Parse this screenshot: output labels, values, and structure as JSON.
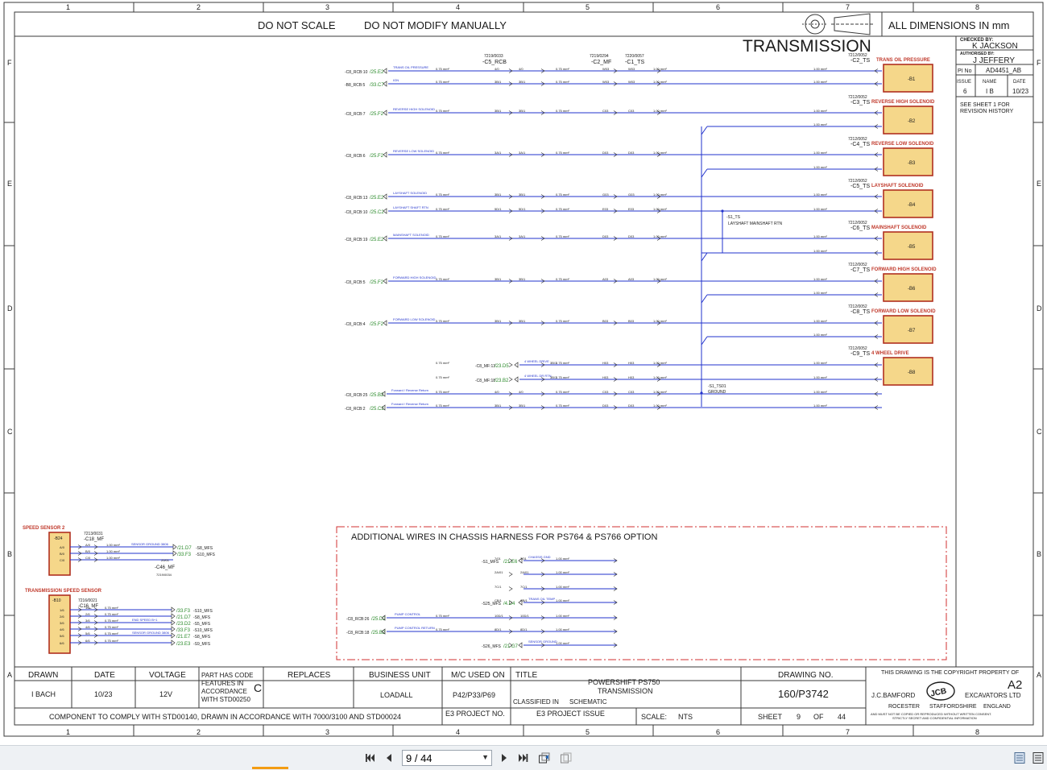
{
  "border": {
    "columns": [
      "1",
      "2",
      "3",
      "4",
      "5",
      "6",
      "7",
      "8"
    ],
    "rows": [
      "F",
      "E",
      "D",
      "C",
      "B",
      "A"
    ]
  },
  "header": {
    "do_not_scale": "DO NOT SCALE",
    "do_not_modify": "DO NOT MODIFY MANUALLY",
    "dimensions": "ALL DIMENSIONS IN mm",
    "sheet_title": "TRANSMISSION"
  },
  "approval": {
    "checked_by_label": "CHECKED BY:",
    "checked_by": "K JACKSON",
    "authorised_by_label": "AUTHORISED BY:",
    "authorised_by": "J JEFFERY",
    "pi_no_label": "PI No",
    "pi_no": "AD4451_AB",
    "issue_label": "ISSUE",
    "name_label": "NAME",
    "date_label": "DATE",
    "issue": "6",
    "name": "I B",
    "date": "10/23",
    "revision_note_1": "SEE SHEET 1 FOR",
    "revision_note_2": "REVISION HISTORY"
  },
  "connectors_top": [
    {
      "part": "7219/0033",
      "name": "-C5_RCB"
    },
    {
      "part": "7219/0294",
      "name": "-C2_MF"
    },
    {
      "part": "7220/0057",
      "name": "-C1_TS"
    }
  ],
  "wires": [
    {
      "src": "-C8_RCB:10",
      "ref": "/25.E2",
      "sig": "TRANS OIL PRESSURE"
    },
    {
      "src": "-B8_RCB:5",
      "ref": "/33.C7",
      "sig": "IGN"
    },
    {
      "src": "-C8_RCB:7",
      "ref": "/25.F2",
      "sig": "REVERSE HIGH SOLENOID"
    },
    {
      "src": "-C8_RCB:6",
      "ref": "/25.F2",
      "sig": "REVERSE LOW SOLENOID"
    },
    {
      "src": "-C8_RCB:13",
      "ref": "/25.E2",
      "sig": "LAYSHAFT SOLENOID"
    },
    {
      "src": "-C8_RCB:10",
      "ref": "/25.C2",
      "sig": "LAYSHAFT SHAFT RTN"
    },
    {
      "src": "-C8_RCB:19",
      "ref": "/25.E2",
      "sig": "MAINSHAFT SOLENOID"
    },
    {
      "src": "-C8_RCB:5",
      "ref": "/25.F2",
      "sig": "FORWARD HIGH SOLENOID"
    },
    {
      "src": "-C8_RCB:4",
      "ref": "/25.F2",
      "sig": "FORWARD LOW SOLENOID"
    },
    {
      "src": "-C8_MF:13",
      "ref": "/23.D5",
      "sig": "4 WHEEL DRIVE"
    },
    {
      "src": "-C8_MF:18",
      "ref": "/23.B2",
      "sig": "4 WHEEL DR RTN"
    },
    {
      "src": "-C8_RCB:25",
      "ref": "/25.B2",
      "sig": "Forward / Reverse Return"
    },
    {
      "src": "-C8_RCB:2",
      "ref": "/25.C2",
      "sig": "Forward / Reverse Return"
    }
  ],
  "wire_codes": {
    "size": "0.75 mm²",
    "size_b": "1.00 mm²",
    "c5": [
      "4/0",
      "3B/1",
      "3B/1",
      "3A/1",
      "3B/1",
      "5D/1",
      "3A/1",
      "3B/1",
      "3B/1",
      "3B/1",
      "3B/1"
    ],
    "c2": [
      "W03",
      "W03",
      "C03",
      "D03",
      "G03",
      "E03",
      "D03",
      "A03",
      "B03",
      "H03",
      "H03",
      "C03",
      "D03"
    ]
  },
  "solenoids": [
    {
      "conn_part": "7212/0052",
      "conn": "-C2_TS",
      "title": "TRANS OIL PRESSURE",
      "id": "-B1"
    },
    {
      "conn_part": "7212/0052",
      "conn": "-C3_TS",
      "title": "REVERSE HIGH SOLENOID",
      "id": "-B2"
    },
    {
      "conn_part": "7212/0052",
      "conn": "-C4_TS",
      "title": "REVERSE LOW SOLENOID",
      "id": "-B3"
    },
    {
      "conn_part": "7212/0052",
      "conn": "-C5_TS",
      "title": "LAYSHAFT SOLENOID",
      "id": "-B4"
    },
    {
      "conn_part": "7212/0052",
      "conn": "-C6_TS",
      "title": "MAINSHAFT SOLENOID",
      "id": "-B5"
    },
    {
      "conn_part": "7212/0052",
      "conn": "-C7_TS",
      "title": "FORWARD HIGH SOLENOID",
      "id": "-B6"
    },
    {
      "conn_part": "7212/0052",
      "conn": "-C8_TS",
      "title": "FORWARD LOW SOLENOID",
      "id": "-B7"
    },
    {
      "conn_part": "7212/0052",
      "conn": "-C9_TS",
      "title": "4 WHEEL DRIVE",
      "id": "-B8"
    }
  ],
  "splice_layshaft": {
    "id": "-S1_TS",
    "label": "LAYSHAFT MAINSHAFT RTN"
  },
  "splice_ground": {
    "id": "-S1_TS01",
    "label": "GROUND"
  },
  "speed_sensor_2": {
    "title": "SPEED SENSOR 2",
    "id": "-B24",
    "conn_part": "7213/0031",
    "conn": "-C18_MF",
    "pins": [
      "A/0",
      "B/0",
      "C/0"
    ],
    "sigs": [
      "SENSOR GROUND 3806",
      "",
      ""
    ],
    "refs": [
      "/21.D7",
      "/33.F3",
      ""
    ],
    "dests": [
      "-S8_MFS",
      "-S10_MFS",
      ""
    ],
    "sub_conn": "-C46_MF",
    "sub_part": "7219/0034",
    "sub_pin": "20/01"
  },
  "trans_speed_sensor": {
    "title": "TRANSMISSION SPEED SENSOR",
    "id": "-B10",
    "conn_part": "7216/0021",
    "conn": "-C16_MF",
    "pins": [
      "1/6",
      "2/6",
      "3/6",
      "4/6",
      "5/6",
      "6/6"
    ],
    "sigs": [
      "",
      "",
      "END SPEED B+1",
      "",
      "SENSOR GROUND 3806",
      ""
    ],
    "refs": [
      "/33.F3",
      "/21.D7",
      "/23.D2",
      "/33.F3",
      "/21.E7",
      "/23.E3"
    ],
    "dests": [
      "-S10_MFS",
      "-S8_MFS",
      "-S5_MFS",
      "-S10_MFS",
      "-S8_MFS",
      "-S9_MFS"
    ]
  },
  "additional": {
    "title": "ADDITIONAL WIRES IN CHASSIS HARNESS FOR PS764 & PS766 OPTION",
    "rows": [
      {
        "src": "-S1_MFS",
        "ref": "/21.E6",
        "sig": "CHASSIS GND",
        "code": "7/01"
      },
      {
        "src": "",
        "ref": "",
        "sig": "",
        "code": "2A/01"
      },
      {
        "src": "",
        "ref": "",
        "sig": "",
        "code": "7C/1"
      },
      {
        "src": "-S25_MFS",
        "ref": "/4.D4",
        "sig": "TRANS OIL TEMP",
        "code": "CB/1"
      },
      {
        "src": "-C8_RCB:26",
        "ref": "/25.D2",
        "sig": "PUMP CONTROL",
        "code": "10D/1"
      },
      {
        "src": "-C8_RCB:18",
        "ref": "/25.B2",
        "sig": "PUMP CONTROL RETURN",
        "code": "8D/1"
      },
      {
        "src": "-S26_MFS",
        "ref": "/21.G7",
        "sig": "SENSOR GROUND",
        "code": ""
      }
    ]
  },
  "title_block": {
    "drawn_label": "DRAWN",
    "drawn": "I BACH",
    "date_label": "DATE",
    "date": "10/23",
    "voltage_label": "VOLTAGE",
    "voltage": "12V",
    "part_code_label": "PART HAS CODE FEATURES IN ACCORDANCE WITH STD00250",
    "part_code_1": "PART HAS CODE",
    "part_code_2": "FEATURES IN",
    "part_code_3": "ACCORDANCE",
    "part_code_4": "WITH STD00250",
    "part_code_letter": "C",
    "replaces_label": "REPLACES",
    "replaces": "",
    "business_unit_label": "BUSINESS UNIT",
    "business_unit": "LOADALL",
    "mc_used_on_label": "M/C USED ON",
    "mc_used_on": "P42/P33/P69",
    "title_label": "TITLE",
    "title_line1": "POWERSHIFT PS750",
    "title_line2": "TRANSMISSION",
    "classified_label": "CLASSIFIED IN",
    "classified": "SCHEMATIC",
    "drawing_no_label": "DRAWING NO.",
    "drawing_no": "160/P3742",
    "comply": "COMPONENT TO COMPLY WITH STD00140, DRAWN IN ACCORDANCE WITH 7000/3100 AND STD00024",
    "e3_project_no": "E3 PROJECT NO.",
    "e3_project_issue": "E3 PROJECT ISSUE",
    "scale_label": "SCALE:",
    "scale": "NTS",
    "sheet_label": "SHEET",
    "sheet": "9",
    "of_label": "OF",
    "sheets": "44",
    "copyright": "THIS DRAWING IS THE COPYRIGHT PROPERTY OF",
    "size": "A2",
    "company_left": "J.C.BAMFORD",
    "company_right": "EXCAVATORS LTD",
    "logo": "JCB",
    "addr1": "ROCESTER",
    "addr2": "STAFFORDSHIRE",
    "addr3": "ENGLAND",
    "notice1": "AND MUST NOT BE COPIED OR REPRODUCED WITHOUT WRITTEN CONSENT.",
    "notice2": "STRICTLY SECRET AND CONFIDENTIAL INFORMATION"
  },
  "viewer": {
    "page_value": "9 / 44",
    "icons": [
      "first-page-icon",
      "prev-page-icon",
      "next-page-icon",
      "last-page-icon",
      "link-icon",
      "copy-icon",
      "page-view-icon",
      "scroll-view-icon"
    ],
    "accent": "#f39c12"
  },
  "colors": {
    "wire": "#2233cc",
    "frame": "#3a3a3a",
    "component": "#c0392b",
    "fill": "#f5d78a",
    "ref": "#2a8a2a",
    "label": "#1a1a1a"
  }
}
